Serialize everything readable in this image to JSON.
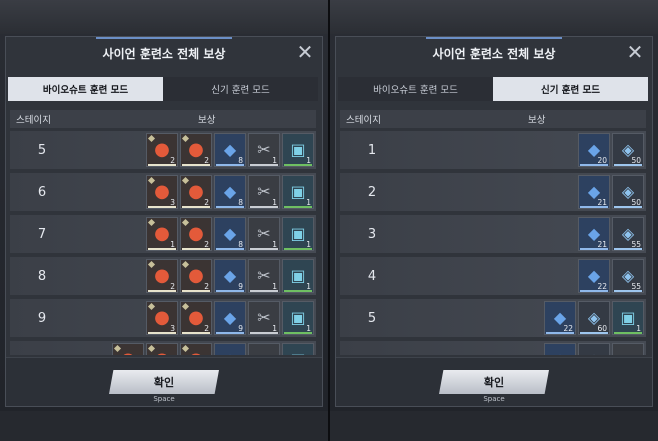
{
  "left_panel": {
    "title": "사이언 훈련소 전체 보상",
    "tabs": [
      {
        "label": "바이오슈트 훈련 모드",
        "active": true
      },
      {
        "label": "신기 훈련 모드",
        "active": false
      }
    ],
    "columns": {
      "stage": "스테이지",
      "reward": "보상"
    },
    "rows": [
      {
        "stage": "5",
        "items": [
          {
            "type": "orb",
            "count": "2"
          },
          {
            "type": "orb",
            "count": "2"
          },
          {
            "type": "cube",
            "count": "8"
          },
          {
            "type": "tool",
            "count": "1"
          },
          {
            "type": "chip",
            "count": "1"
          }
        ]
      },
      {
        "stage": "6",
        "items": [
          {
            "type": "orb",
            "count": "3"
          },
          {
            "type": "orb",
            "count": "2"
          },
          {
            "type": "cube",
            "count": "8"
          },
          {
            "type": "tool",
            "count": "1"
          },
          {
            "type": "chip",
            "count": "1"
          }
        ]
      },
      {
        "stage": "7",
        "items": [
          {
            "type": "orb",
            "count": "1"
          },
          {
            "type": "orb",
            "count": "2"
          },
          {
            "type": "cube",
            "count": "8"
          },
          {
            "type": "tool",
            "count": "1"
          },
          {
            "type": "chip",
            "count": "1"
          }
        ]
      },
      {
        "stage": "8",
        "items": [
          {
            "type": "orb",
            "count": "2"
          },
          {
            "type": "orb",
            "count": "2"
          },
          {
            "type": "cube",
            "count": "9"
          },
          {
            "type": "tool",
            "count": "1"
          },
          {
            "type": "chip",
            "count": "1"
          }
        ]
      },
      {
        "stage": "9",
        "items": [
          {
            "type": "orb",
            "count": "3"
          },
          {
            "type": "orb",
            "count": "2"
          },
          {
            "type": "cube",
            "count": "9"
          },
          {
            "type": "tool",
            "count": "1"
          },
          {
            "type": "chip",
            "count": "1"
          }
        ]
      },
      {
        "stage": "",
        "items": [
          {
            "type": "orb",
            "count": ""
          },
          {
            "type": "orb",
            "count": ""
          },
          {
            "type": "orb",
            "count": ""
          },
          {
            "type": "cube",
            "count": ""
          },
          {
            "type": "tool",
            "count": ""
          },
          {
            "type": "chip",
            "count": ""
          }
        ]
      }
    ],
    "confirm_label": "확인",
    "confirm_hint": "Space"
  },
  "right_panel": {
    "title": "사이언 훈련소 전체 보상",
    "tabs": [
      {
        "label": "바이오슈트 훈련 모드",
        "active": false
      },
      {
        "label": "신기 훈련 모드",
        "active": true
      }
    ],
    "columns": {
      "stage": "스테이지",
      "reward": "보상"
    },
    "rows": [
      {
        "stage": "1",
        "items": [
          {
            "type": "cube",
            "count": "20"
          },
          {
            "type": "tube",
            "count": "50"
          }
        ]
      },
      {
        "stage": "2",
        "items": [
          {
            "type": "cube",
            "count": "21"
          },
          {
            "type": "tube",
            "count": "50"
          }
        ]
      },
      {
        "stage": "3",
        "items": [
          {
            "type": "cube",
            "count": "21"
          },
          {
            "type": "tube",
            "count": "55"
          }
        ]
      },
      {
        "stage": "4",
        "items": [
          {
            "type": "cube",
            "count": "22"
          },
          {
            "type": "tube",
            "count": "55"
          }
        ]
      },
      {
        "stage": "5",
        "items": [
          {
            "type": "cube",
            "count": "22"
          },
          {
            "type": "tube",
            "count": "60"
          },
          {
            "type": "chip",
            "count": "1"
          }
        ]
      },
      {
        "stage": "",
        "items": [
          {
            "type": "cube",
            "count": ""
          },
          {
            "type": "tube",
            "count": ""
          },
          {
            "type": "tool",
            "count": ""
          }
        ]
      }
    ],
    "confirm_label": "확인",
    "confirm_hint": "Space"
  },
  "icons": {
    "orb": "orb-icon",
    "cube": "cube-icon",
    "tool": "tool-icon",
    "chip": "chip-icon",
    "tube": "capsule-icon",
    "close": "close-icon"
  },
  "colors": {
    "active_tab": "#dfe3ea",
    "accent_line": "#6b8fc7",
    "chip_bar": "#6fbf62"
  }
}
